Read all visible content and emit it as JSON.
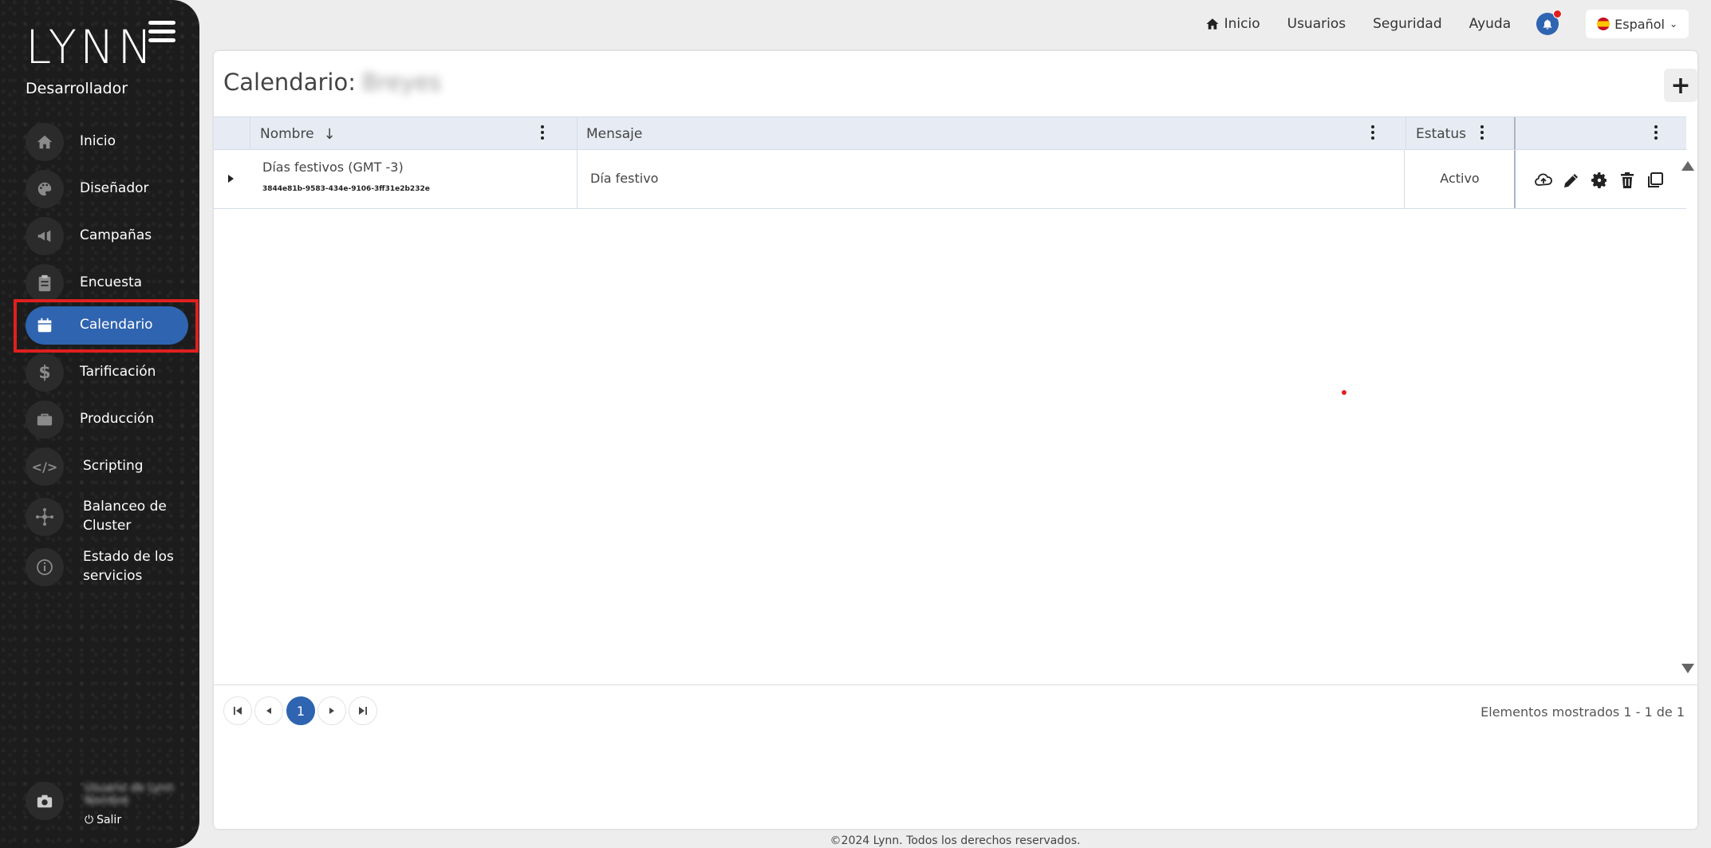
{
  "sidebar": {
    "brand": "LYNN",
    "role": "Desarrollador",
    "items": [
      {
        "label": "Inicio"
      },
      {
        "label": "Diseñador"
      },
      {
        "label": "Campañas"
      },
      {
        "label": "Encuesta"
      },
      {
        "label": "Calendario"
      },
      {
        "label": "Tarificación"
      },
      {
        "label": "Producción"
      },
      {
        "label": "Scripting"
      },
      {
        "label": "Balanceo de Cluster"
      },
      {
        "label": "Estado de los servicios"
      }
    ],
    "user_name": "Usuario de Lynn Nombre",
    "logout_label": "Salir"
  },
  "topnav": {
    "home_label": "Inicio",
    "users_label": "Usuarios",
    "security_label": "Seguridad",
    "help_label": "Ayuda",
    "language_label": "Español"
  },
  "page": {
    "title": "Calendario:",
    "title_suffix": "Breyes",
    "add_label": "+"
  },
  "grid": {
    "columns": {
      "name": "Nombre",
      "message": "Mensaje",
      "status": "Estatus"
    },
    "rows": [
      {
        "name": "Días festivos (GMT -3)",
        "id": "3844e81b-9583-434e-9106-3ff31e2b232e",
        "message": "Día festivo",
        "status": "Activo"
      }
    ]
  },
  "pager": {
    "current_page": "1",
    "info": "Elementos mostrados 1 - 1 de 1"
  },
  "footer": {
    "text": "©2024 Lynn. Todos los derechos reservados."
  },
  "colors": {
    "accent": "#2f64b0",
    "sidebar_bg": "#1c1c1c",
    "highlight": "#e02020"
  }
}
